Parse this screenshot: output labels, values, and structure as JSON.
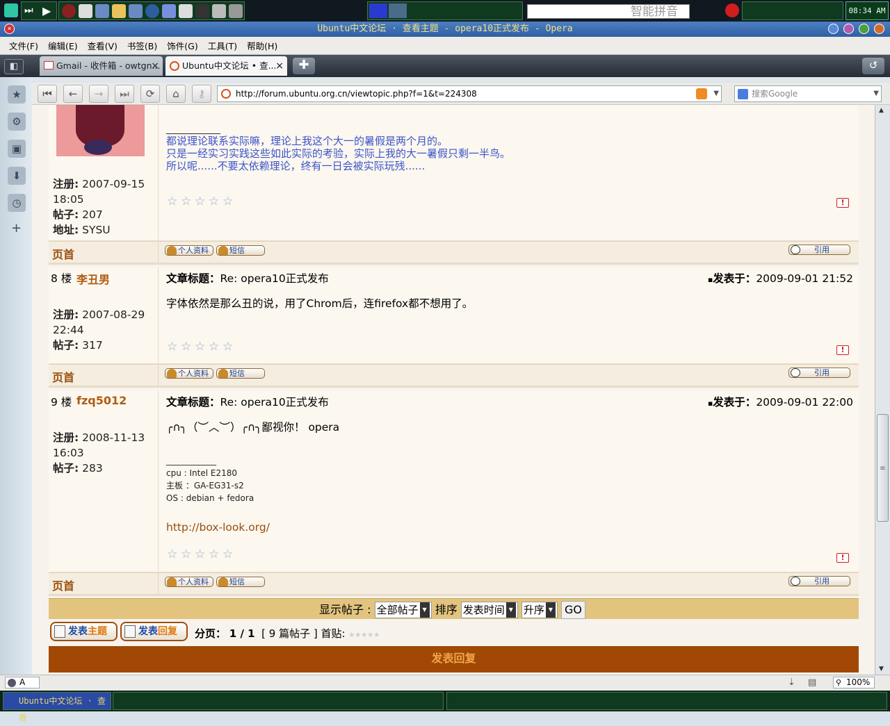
{
  "panel": {
    "clock": "08:34 AM",
    "ime_label": "智能拼音"
  },
  "window": {
    "title": "Ubuntu中文论坛 · 查看主题 - opera10正式发布 - Opera"
  },
  "menu": [
    "文件(F)",
    "编辑(E)",
    "查看(V)",
    "书签(B)",
    "饰件(G)",
    "工具(T)",
    "帮助(H)"
  ],
  "tabs": [
    {
      "label": "Gmail - 收件箱 - owtgn...",
      "close": "×"
    },
    {
      "label": "Ubuntu中文论坛 • 查...",
      "close": "×"
    }
  ],
  "address": {
    "url": "http://forum.ubuntu.org.cn/viewtopic.php?f=1&t=224308",
    "search_placeholder": "搜索Google"
  },
  "posts": [
    {
      "reg_label": "注册:",
      "reg": "2007-09-15 18:05",
      "posts_label": "帖子:",
      "posts": "207",
      "addr_label": "地址:",
      "addr": "SYSU",
      "sig_sep": "____________",
      "sig_lines": [
        "都说理论联系实际嘛，理论上我这个大一的暑假是两个月的。",
        "只是一经实习实践这些如此实际的考验，实际上我的大一暑假只剩一半鸟。",
        "所以呢......不要太依赖理论，终有一日会被实际玩残......"
      ]
    },
    {
      "floor": "8 楼",
      "user": "李丑男",
      "subject_label": "文章标题：",
      "subject": "Re: opera10正式发布",
      "date_label": "发表于：",
      "date": "2009-09-01 21:52",
      "reg_label": "注册:",
      "reg": "2007-08-29 22:44",
      "posts_label": "帖子:",
      "posts": "317",
      "text": "字体依然是那么丑的说，用了Chrom后，连firefox都不想用了。"
    },
    {
      "floor": "9 楼",
      "user": "fzq5012",
      "subject_label": "文章标题：",
      "subject": "Re: opera10正式发布",
      "date_label": "发表于：",
      "date": "2009-09-01 22:00",
      "reg_label": "注册:",
      "reg": "2008-11-13 16:03",
      "posts_label": "帖子:",
      "posts": "283",
      "text": "╭∩╮（︶︿︶）╭∩╮鄙视你！ opera",
      "sig_sep": "____________",
      "sig_lines": [
        "cpu : Intel E2180",
        "主板 ：GA-EG31-s2",
        "OS : debian + fedora"
      ],
      "sig_link": "http://box-look.org/"
    }
  ],
  "common": {
    "top": "页首",
    "profile": "个人资料",
    "pm": "短信",
    "quote": "引用"
  },
  "sort": {
    "show_label": "显示帖子 :",
    "show_value": "全部帖子",
    "order_label": "排序",
    "order_value": "发表时间",
    "dir_value": "升序",
    "go": "GO"
  },
  "pager": {
    "new_topic_a": "发表",
    "new_topic_b": "主题",
    "reply_a": "发表",
    "reply_b": "回复",
    "pages_label": "分页：",
    "pages": "1 / 1",
    "count": "[ 9 篇帖子 ]",
    "first": "首贴:"
  },
  "reply_bar": "发表回复",
  "status": {
    "zoom": "100%",
    "ime": "A"
  },
  "taskbar": {
    "item": "Ubuntu中文论坛 · 查看"
  }
}
